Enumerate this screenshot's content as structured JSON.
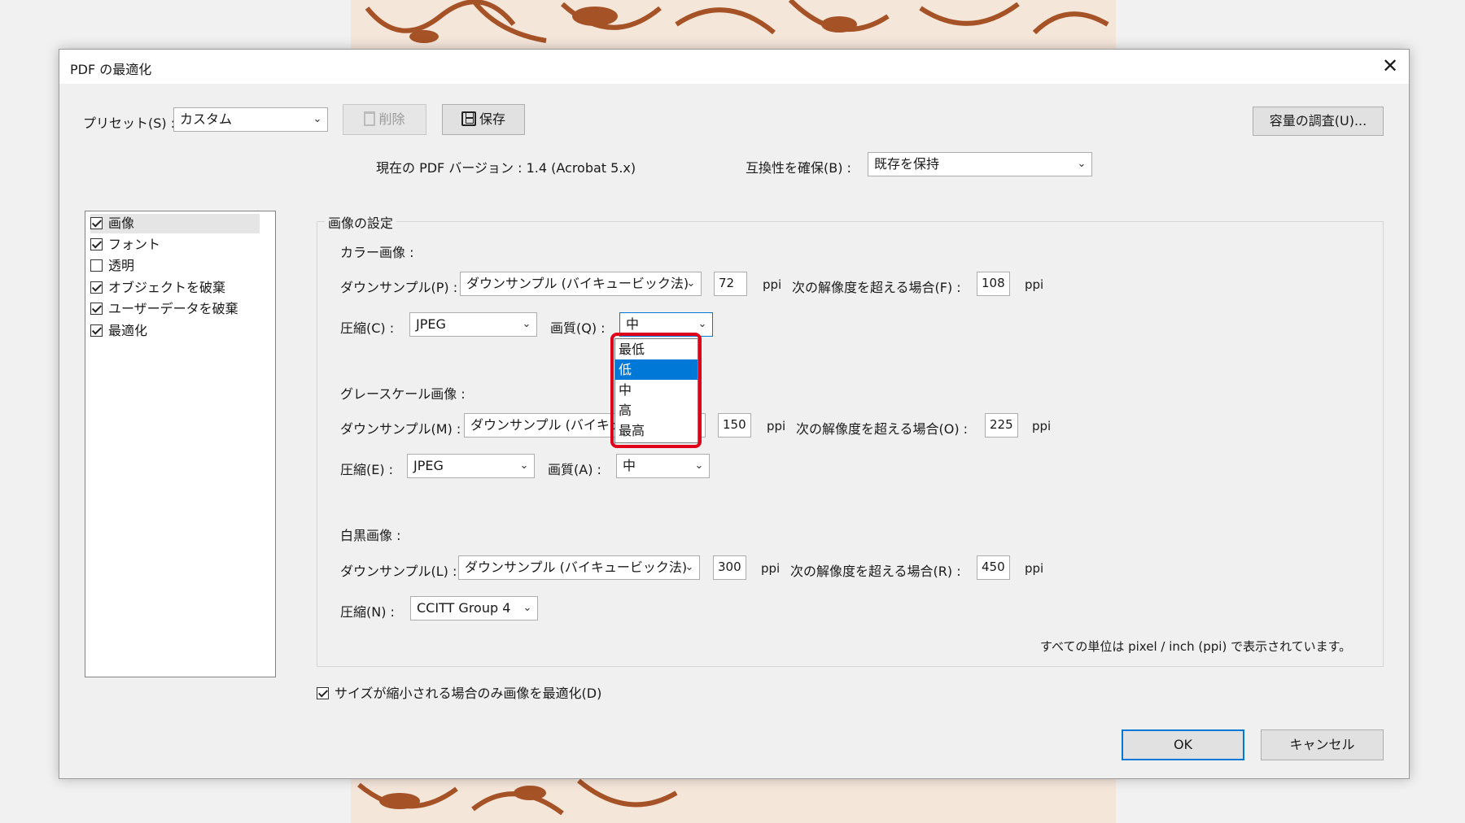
{
  "dialog": {
    "title": "PDF の最適化",
    "close": "✕"
  },
  "preset": {
    "label": "プリセット(S) :",
    "value": "カスタム",
    "delete_label": "削除",
    "save_label": "保存",
    "audit_label": "容量の調査(U)..."
  },
  "version": {
    "text": "現在の PDF バージョン : 1.4 (Acrobat 5.x)",
    "compat_label": "互換性を確保(B) :",
    "compat_value": "既存を保持"
  },
  "categories": {
    "items": [
      {
        "label": "画像",
        "checked": true
      },
      {
        "label": "フォント",
        "checked": true
      },
      {
        "label": "透明",
        "checked": false
      },
      {
        "label": "オブジェクトを破棄",
        "checked": true
      },
      {
        "label": "ユーザーデータを破棄",
        "checked": true
      },
      {
        "label": "最適化",
        "checked": true
      }
    ]
  },
  "image_settings": {
    "title": "画像の設定",
    "color": {
      "title": "カラー画像 :",
      "downsample_label": "ダウンサンプル(P) :",
      "downsample_value": "ダウンサンプル (バイキュービック法)",
      "res": "72",
      "ppi": "ppi",
      "above_label": "次の解像度を超える場合(F) :",
      "above_res": "108",
      "compress_label": "圧縮(C) :",
      "compress_value": "JPEG",
      "quality_label": "画質(Q) :",
      "quality_value": "中"
    },
    "gray": {
      "title": "グレースケール画像 :",
      "downsample_label": "ダウンサンプル(M) :",
      "downsample_value": "ダウンサンプル (バイキュービック法)",
      "res": "150",
      "ppi": "ppi",
      "above_label": "次の解像度を超える場合(O) :",
      "above_res": "225",
      "compress_label": "圧縮(E) :",
      "compress_value": "JPEG",
      "quality_label": "画質(A) :",
      "quality_value": "中"
    },
    "mono": {
      "title": "白黒画像 :",
      "downsample_label": "ダウンサンプル(L) :",
      "downsample_value": "ダウンサンプル (バイキュービック法)",
      "res": "300",
      "ppi": "ppi",
      "above_label": "次の解像度を超える場合(R) :",
      "above_res": "450",
      "compress_label": "圧縮(N) :",
      "compress_value": "CCITT Group 4"
    },
    "units_note": "すべての単位は pixel / inch (ppi) で表示されています。"
  },
  "quality_dropdown": {
    "options": [
      "最低",
      "低",
      "中",
      "高",
      "最高"
    ],
    "highlighted": "低",
    "highlight_color": "#e0001a"
  },
  "optimize_only_if_smaller": {
    "label": "サイズが縮小される場合のみ画像を最適化(D)",
    "checked": true
  },
  "footer": {
    "ok": "OK",
    "cancel": "キャンセル"
  }
}
